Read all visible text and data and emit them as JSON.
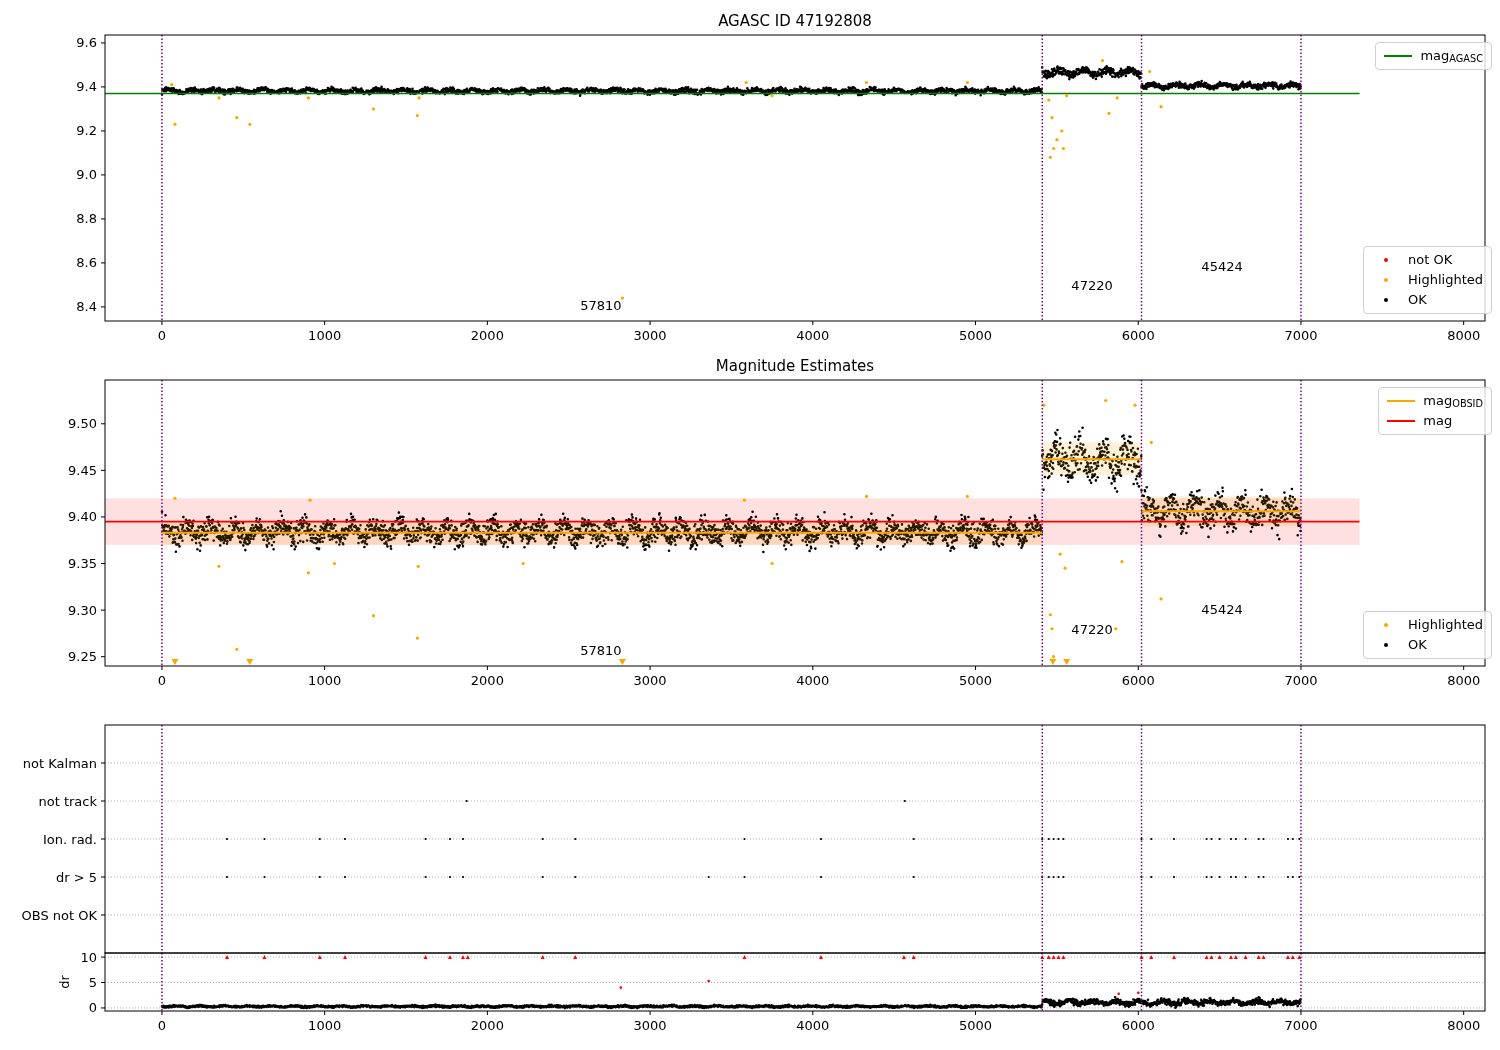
{
  "panels": [
    {
      "kind": "mag",
      "title": "AGASC ID 47192808",
      "yticks": [
        "9.6",
        "9.4",
        "9.2",
        "9.0",
        "8.8",
        "8.6",
        "8.4"
      ],
      "xticks": [
        "0",
        "1000",
        "2000",
        "3000",
        "4000",
        "5000",
        "6000",
        "7000",
        "8000"
      ],
      "run_labels": [
        "57810",
        "47220",
        "45424"
      ],
      "legends": [
        {
          "entries": [
            {
              "label": "mag$_{AGASC}$",
              "kind": "line",
              "color": "#008000"
            }
          ]
        },
        {
          "entries": [
            {
              "label": "not OK",
              "kind": "dot",
              "color": "#ff0000"
            },
            {
              "label": "Highlighted",
              "kind": "dot",
              "color": "#ffa500"
            },
            {
              "label": "OK",
              "kind": "dot",
              "color": "#000000"
            }
          ]
        }
      ]
    },
    {
      "kind": "mag",
      "title": "Magnitude Estimates",
      "yticks": [
        "9.50",
        "9.45",
        "9.40",
        "9.35",
        "9.30",
        "9.25"
      ],
      "xticks": [
        "0",
        "1000",
        "2000",
        "3000",
        "4000",
        "5000",
        "6000",
        "7000",
        "8000"
      ],
      "run_labels": [
        "57810",
        "47220",
        "45424"
      ],
      "legends": [
        {
          "entries": [
            {
              "label": "mag$_{OBSID}$",
              "kind": "line",
              "color": "#ffa500"
            },
            {
              "label": "mag",
              "kind": "line",
              "color": "#ff0000"
            }
          ]
        },
        {
          "entries": [
            {
              "label": "Highlighted",
              "kind": "dot",
              "color": "#ffa500"
            },
            {
              "label": "OK",
              "kind": "dot",
              "color": "#000000"
            }
          ]
        }
      ]
    },
    {
      "kind": "flags",
      "row_labels": [
        "not Kalman",
        "not track",
        "Ion. rad.",
        "dr > 5",
        "OBS not OK"
      ],
      "dr_label": "dr",
      "dr_yticks": [
        "10",
        "5",
        "0"
      ],
      "xticks": [
        "0",
        "1000",
        "2000",
        "3000",
        "4000",
        "5000",
        "6000",
        "7000",
        "8000"
      ]
    }
  ]
}
